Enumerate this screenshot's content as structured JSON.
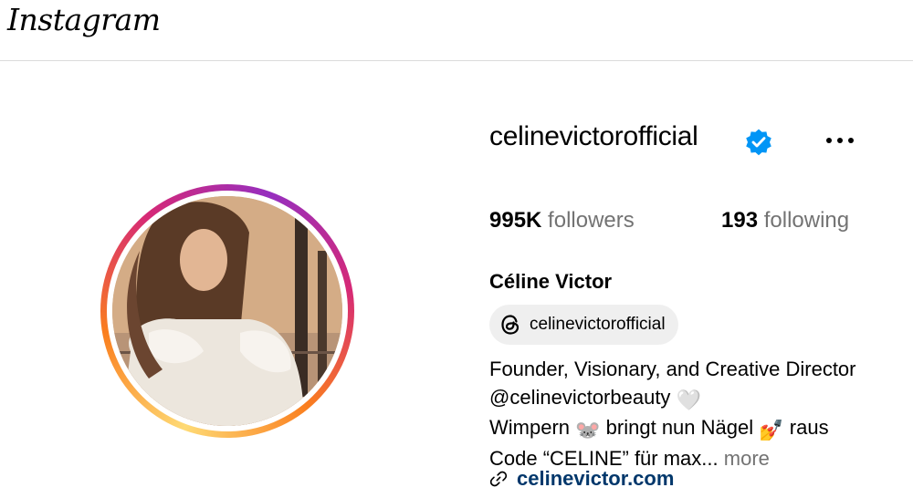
{
  "header": {
    "logo_text": "Instagram"
  },
  "profile": {
    "username": "celinevictorofficial",
    "verified": true,
    "followers_count": "995K",
    "followers_label": "followers",
    "following_count": "193",
    "following_label": "following",
    "full_name": "Céline Victor",
    "threads_handle": "celinevictorofficial",
    "bio": {
      "line1": "Founder, Visionary, and Creative Director",
      "line2_text": "@celinevictorbeauty",
      "line2_emoji": "🤍",
      "line3_a": "Wimpern",
      "line3_emoji1": "🐭",
      "line3_b": "bringt nun Nägel",
      "line3_emoji2": "💅",
      "line3_c": "raus",
      "line4_text": "Code “CELINE” für max...",
      "more_label": "more"
    },
    "website": "celinevictor.com"
  },
  "colors": {
    "accent_link": "#00376b",
    "secondary_text": "#737373",
    "verified_blue": "#0095f6",
    "chip_bg": "#efefef"
  },
  "icons": {
    "verified": "verified-badge-icon",
    "more": "more-options-icon",
    "threads": "threads-icon",
    "link": "link-icon"
  }
}
